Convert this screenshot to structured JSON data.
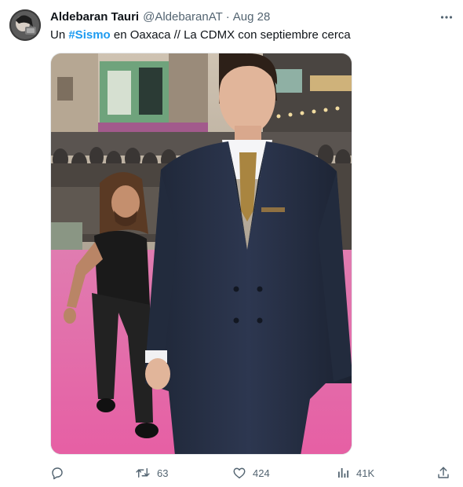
{
  "author": {
    "display_name": "Aldebaran Tauri",
    "handle": "@AldebaranAT",
    "separator": "·",
    "date": "Aug 28"
  },
  "tweet": {
    "text_before": "Un ",
    "hashtag": "#Sismo",
    "text_after": " en Oaxaca // La CDMX con septiembre cerca"
  },
  "media": {
    "alt": ""
  },
  "actions": {
    "reply_count": "",
    "retweet_count": "63",
    "like_count": "424",
    "views_count": "41K"
  },
  "colors": {
    "accent": "#1d9bf0",
    "text": "#0f1419",
    "secondary": "#536471",
    "carpet": "#e76aaa"
  },
  "icons": {
    "more": "more-horizontal-icon",
    "reply": "reply-icon",
    "retweet": "retweet-icon",
    "like": "heart-icon",
    "views": "views-icon",
    "share": "share-icon"
  }
}
